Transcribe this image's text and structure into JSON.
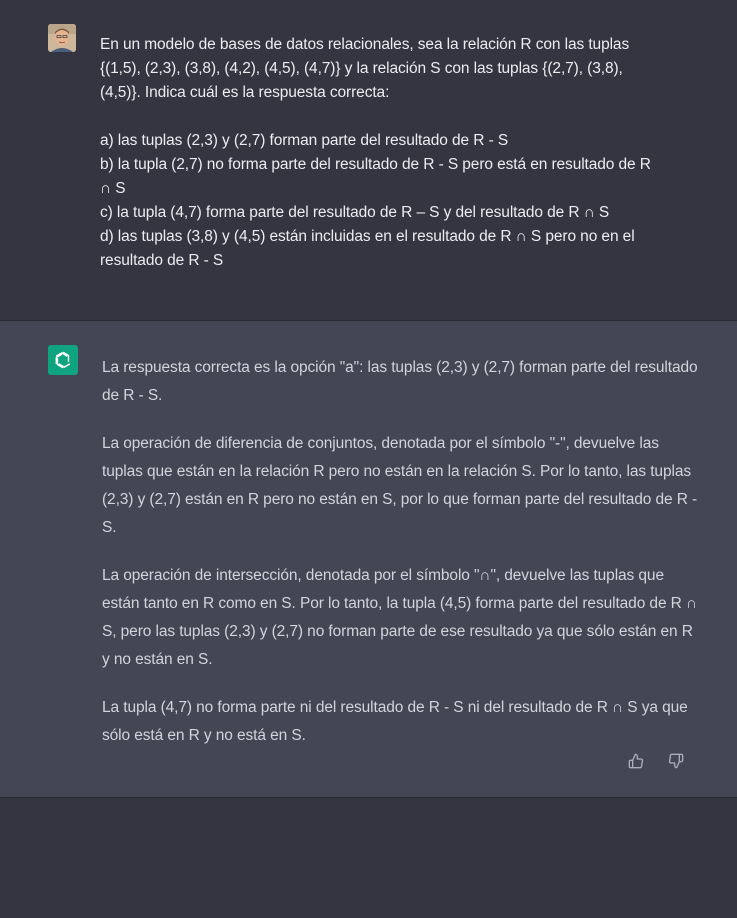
{
  "user_message": {
    "lines": [
      "En un modelo de bases de datos relacionales, sea la relación R con las tuplas",
      "{(1,5), (2,3), (3,8), (4,2), (4,5), (4,7)} y la relación S con las tuplas {(2,7), (3,8),",
      "(4,5)}. Indica cuál es la respuesta correcta:"
    ],
    "options": [
      "a) las tuplas (2,3) y (2,7) forman parte del resultado de R - S",
      "b) la tupla (2,7) no forma parte del resultado de R - S pero está en resultado de R",
      "∩ S",
      "c) la tupla (4,7) forma parte del resultado de R – S y del resultado de R ∩ S",
      "d) las tuplas (3,8) y (4,5) están incluidas en el resultado de R ∩ S pero no en el",
      "resultado de R - S"
    ]
  },
  "assistant_message": {
    "paragraphs": [
      "La respuesta correcta es la opción \"a\": las tuplas (2,3) y (2,7) forman parte del resultado de R - S.",
      "La operación de diferencia de conjuntos, denotada por el símbolo \"-\", devuelve las tuplas que están en la relación R pero no están en la relación S. Por lo tanto, las tuplas (2,3) y (2,7) están en R pero no están en S, por lo que forman parte del resultado de R - S.",
      "La operación de intersección, denotada por el símbolo \"∩\", devuelve las tuplas que están tanto en R como en S. Por lo tanto, la tupla (4,5) forma parte del resultado de R ∩ S, pero las tuplas (2,3) y (2,7) no forman parte de ese resultado ya que sólo están en R y no están en S.",
      "La tupla (4,7) no forma parte ni del resultado de R - S ni del resultado de R ∩ S ya que sólo está en R y no está en S."
    ]
  },
  "icons": {
    "user_avatar": "user-avatar-icon",
    "assistant_avatar": "openai-logo-icon",
    "thumbs_up": "thumbs-up-icon",
    "thumbs_down": "thumbs-down-icon"
  },
  "colors": {
    "background": "#343541",
    "assistant_background": "#444654",
    "accent": "#10a37f"
  }
}
